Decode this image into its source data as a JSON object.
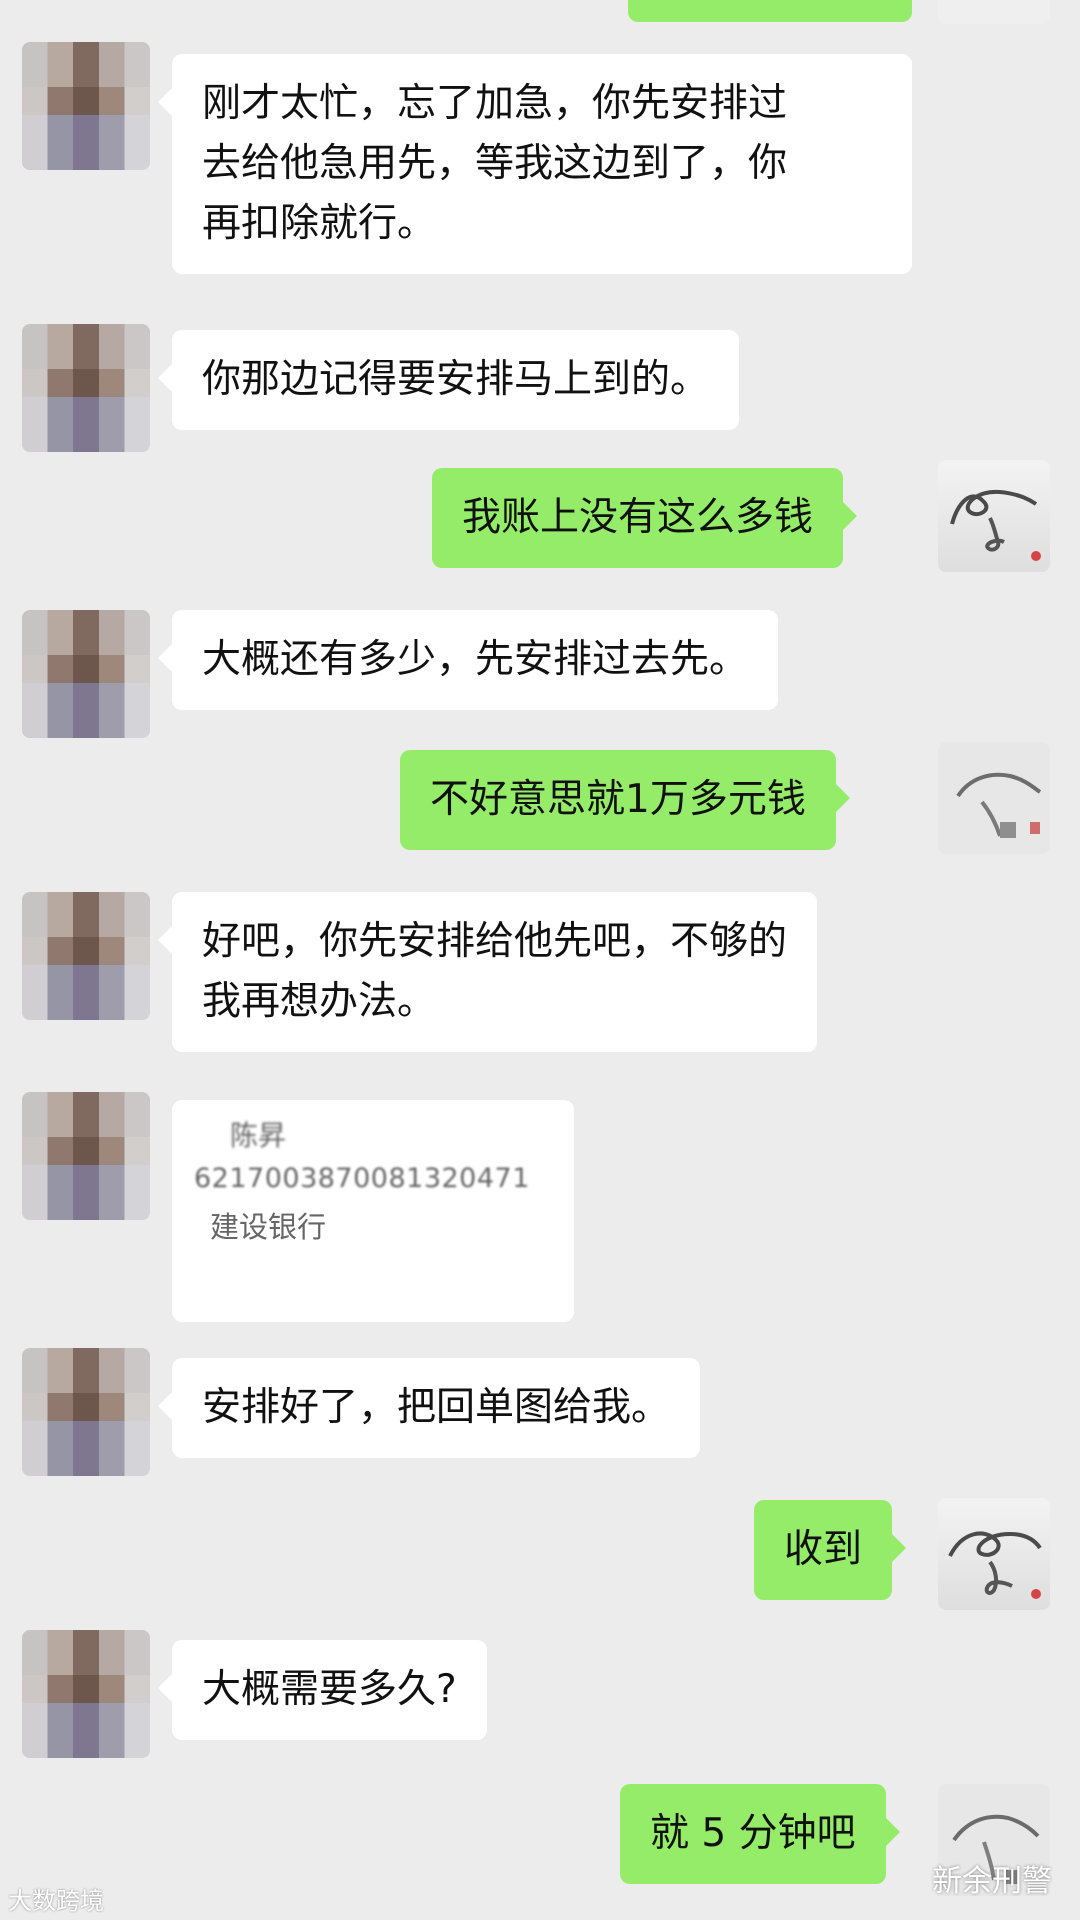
{
  "messages": [
    {
      "side": "left",
      "text": "刚才太忙，忘了加急，你先安排过\n去给他急用先，等我这边到了，你\n再扣除就行。"
    },
    {
      "side": "left",
      "text": "你那边记得要安排马上到的。"
    },
    {
      "side": "right",
      "text": "我账上没有这么多钱"
    },
    {
      "side": "left",
      "text": "大概还有多少，先安排过去先。"
    },
    {
      "side": "right",
      "text": "不好意思就1万多元钱"
    },
    {
      "side": "left",
      "text": "好吧，你先安排给他先吧，不够的\n我再想办法。"
    },
    {
      "side": "left",
      "text": "安排好了，把回单图给我。"
    },
    {
      "side": "right",
      "text": "收到"
    },
    {
      "side": "left",
      "text": "大概需要多久?"
    },
    {
      "side": "right",
      "text": "就 5 分钟吧"
    }
  ],
  "bank_card": {
    "name": "陈昇",
    "account": "6217003870081320471",
    "bank": "建设银行"
  },
  "watermarks": {
    "left": "大数跨境",
    "right": "新余刑警"
  }
}
